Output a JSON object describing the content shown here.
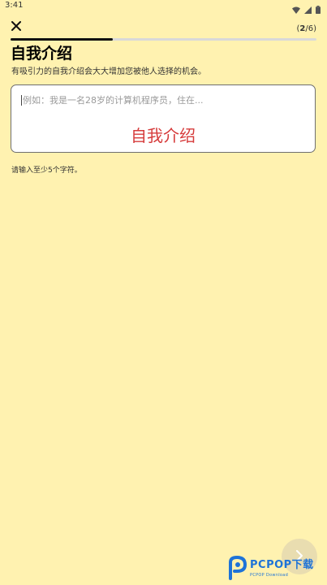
{
  "status_bar": {
    "time": "3:41",
    "icons": [
      "wifi-icon",
      "signal-icon",
      "battery-icon"
    ]
  },
  "header": {
    "close_icon": "close-icon",
    "step_current": "2",
    "step_total": "/6)",
    "step_open": "(",
    "progress": 0.333
  },
  "page": {
    "title": "自我介绍",
    "subtitle": "有吸引力的自我介绍会大大增加您被他人选择的机会。"
  },
  "intro_field": {
    "placeholder": "例如：我是一名28岁的计算机程序员，住在...",
    "value": "",
    "overlay_label": "自我介绍"
  },
  "hint": "请输入至少5个字符。",
  "next_button": {
    "icon": "chevron-right-icon"
  },
  "watermark": {
    "brand": "PCPOP下载",
    "sub": "PCPOP Download"
  },
  "colors": {
    "background": "#FFF2B0",
    "overlay_label": "#D63B3B",
    "watermark": "#1E73D8"
  }
}
